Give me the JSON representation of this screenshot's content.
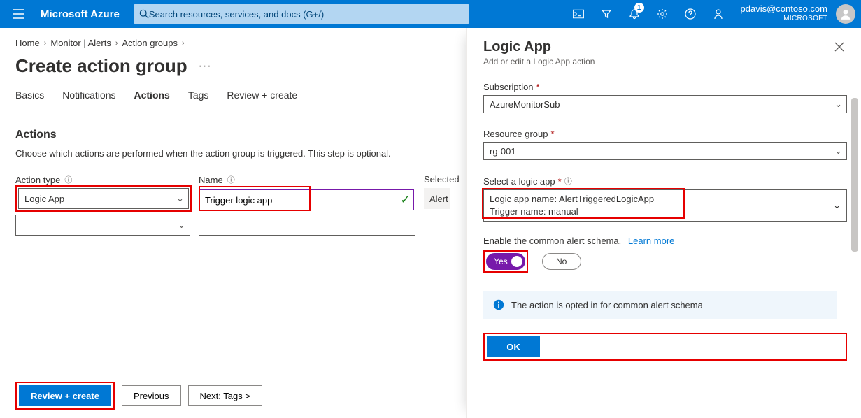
{
  "header": {
    "brand": "Microsoft Azure",
    "search_placeholder": "Search resources, services, and docs (G+/)",
    "notifications_badge": "1",
    "user_email": "pdavis@contoso.com",
    "user_directory": "MICROSOFT"
  },
  "breadcrumbs": {
    "items": [
      "Home",
      "Monitor | Alerts",
      "Action groups"
    ]
  },
  "page": {
    "title": "Create action group"
  },
  "tabs": {
    "items": [
      "Basics",
      "Notifications",
      "Actions",
      "Tags",
      "Review + create"
    ],
    "active_index": 2
  },
  "actions_section": {
    "heading": "Actions",
    "description": "Choose which actions are performed when the action group is triggered. This step is optional.",
    "columns": {
      "type": "Action type",
      "name": "Name",
      "selected": "Selected"
    },
    "rows": [
      {
        "type": "Logic App",
        "name": "Trigger logic app",
        "selected": "AlertTriggeredLogicApp"
      },
      {
        "type": "",
        "name": "",
        "selected": ""
      }
    ]
  },
  "footer": {
    "review": "Review + create",
    "previous": "Previous",
    "next": "Next: Tags >"
  },
  "panel": {
    "title": "Logic App",
    "subtitle": "Add or edit a Logic App action",
    "subscription_label": "Subscription",
    "subscription_value": "AzureMonitorSub",
    "rg_label": "Resource group",
    "rg_value": "rg-001",
    "logicapp_label": "Select a logic app",
    "logicapp_line1": "Logic app name: AlertTriggeredLogicApp",
    "logicapp_line2": "Trigger name: manual",
    "schema_label": "Enable the common alert schema.",
    "learn_more": "Learn more",
    "toggle_yes": "Yes",
    "toggle_no": "No",
    "info_text": "The action is opted in for common alert schema",
    "ok": "OK"
  }
}
